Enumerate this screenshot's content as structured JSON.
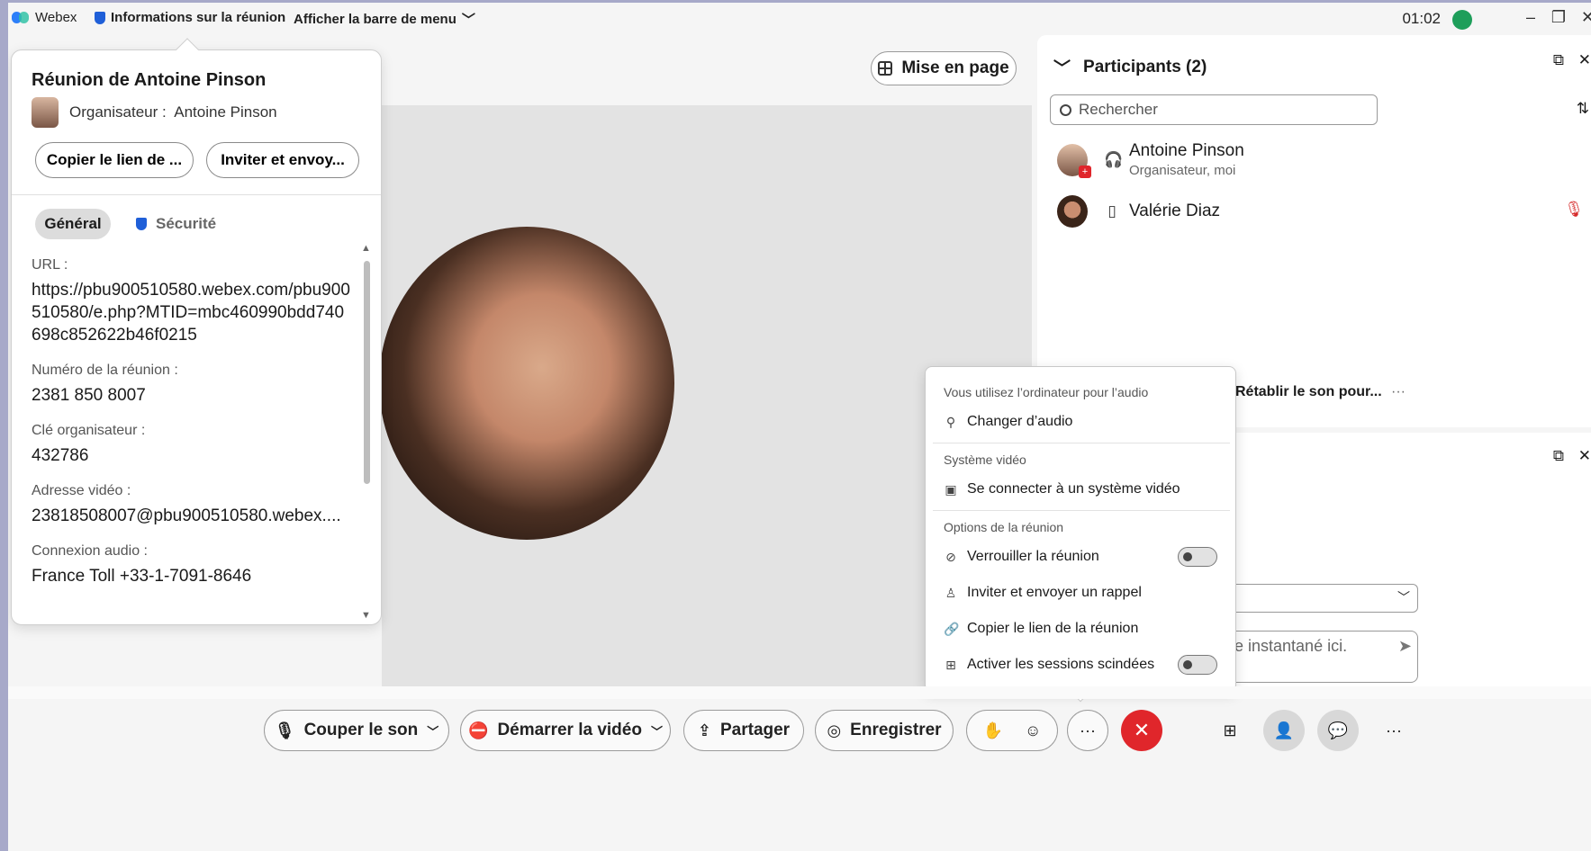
{
  "titlebar": {
    "app_name": "Webex",
    "meeting_info": "Informations sur la réunion",
    "menu_bar": "Afficher la barre de menu",
    "time": "01:02"
  },
  "info_popup": {
    "title": "Réunion de Antoine Pinson",
    "host_label": "Organisateur :",
    "host_name": "Antoine Pinson",
    "copy_link": "Copier le lien de ...",
    "invite": "Inviter et envoy...",
    "tab_general": "Général",
    "tab_security": "Sécurité",
    "fields": [
      {
        "label": "URL :",
        "value": "https://pbu900510580.webex.com/pbu900510580/e.php?MTID=mbc460990bdd740698c852622b46f0215"
      },
      {
        "label": "Numéro de la réunion :",
        "value": "2381 850 8007"
      },
      {
        "label": "Clé organisateur :",
        "value": "432786"
      },
      {
        "label": "Adresse vidéo :",
        "value": "23818508007@pbu900510580.webex...."
      },
      {
        "label": "Connexion audio :",
        "value": "France Toll +33-1-7091-8646"
      }
    ]
  },
  "stage": {
    "layout_label": "Mise en page"
  },
  "participants": {
    "title": "Participants (2)",
    "search_placeholder": "Rechercher",
    "list": [
      {
        "name": "Antoine Pinson",
        "role": "Organisateur, moi"
      },
      {
        "name": "Valérie Diaz",
        "role": ""
      }
    ],
    "unmute_all": "Rétablir le son pour...",
    "chat_placeholder": "e instantané ici."
  },
  "more_menu": {
    "audio_head": "Vous utilisez l’ordinateur pour l’audio",
    "change_audio": "Changer d’audio",
    "video_head": "Système vidéo",
    "connect_video": "Se connecter à un système vidéo",
    "options_head": "Options de la réunion",
    "lock": "Verrouiller la réunion",
    "invite_reminder": "Inviter et envoyer un rappel",
    "copy_link": "Copier le lien de la réunion",
    "breakout": "Activer les sessions scindées"
  },
  "toolbar": {
    "mute": "Couper le son",
    "start_video": "Démarrer la vidéo",
    "share": "Partager",
    "record": "Enregistrer"
  },
  "colors": {
    "end_call": "#e0262b",
    "accent": "#1f5fd8"
  }
}
